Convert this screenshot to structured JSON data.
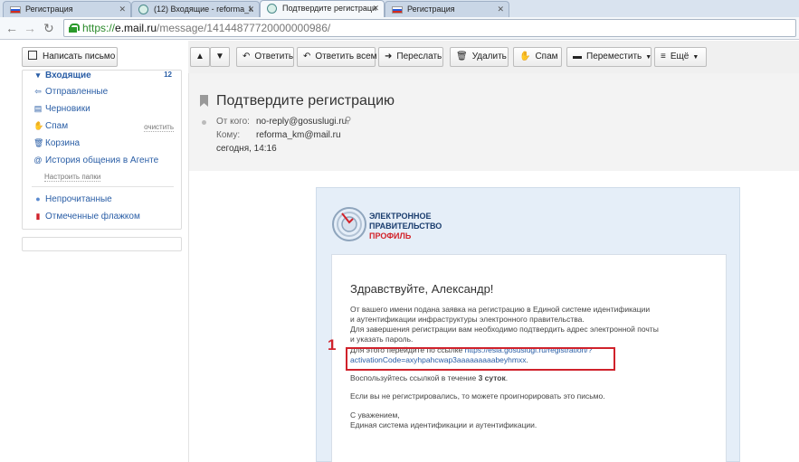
{
  "browser": {
    "tabs": [
      {
        "title": "Регистрация"
      },
      {
        "title": "(12) Входящие - reforma_k"
      },
      {
        "title": "Подтвердите регистраци"
      },
      {
        "title": "Регистрация"
      }
    ],
    "url": {
      "scheme": "https://",
      "host": "e.mail.ru",
      "path": "/message/14144877720000000986/"
    }
  },
  "compose_label": "Написать письмо",
  "toolbar": {
    "reply": "Ответить",
    "reply_all": "Ответить всем",
    "forward": "Переслать",
    "delete": "Удалить",
    "spam": "Спам",
    "move": "Переместить",
    "more": "Ещё"
  },
  "sidebar": {
    "inbox_label": "Входящие",
    "inbox_count": "12",
    "sent": "Отправленные",
    "drafts": "Черновики",
    "spam": "Спам",
    "spam_clear": "очистить",
    "trash": "Корзина",
    "agent_history": "История общения в Агенте",
    "configure_folders": "Настроить папки",
    "unread": "Непрочитанные",
    "flagged": "Отмеченные флажком"
  },
  "message": {
    "subject": "Подтвердите регистрацию",
    "from_label": "От кого:",
    "from_value": "no-reply@gosuslugi.ru",
    "to_label": "Кому:",
    "to_value": "reforma_km@mail.ru",
    "date": "сегодня, 14:16"
  },
  "logo": {
    "line1": "ЭЛЕКТРОННОЕ",
    "line2": "ПРАВИТЕЛЬСТВО",
    "line3": "ПРОФИЛЬ"
  },
  "body": {
    "greeting": "Здравствуйте, Александр!",
    "p1_l1": "От вашего имени подана заявка на регистрацию в Единой системе идентификации",
    "p1_l2": "и аутентификации инфраструктуры электронного правительства.",
    "p1_l3": "Для завершения регистрации вам необходимо подтвердить адрес электронной почты",
    "p1_l4": "и указать пароль.",
    "link_prefix": "Для этого перейдите по ссылке ",
    "link_l1": "https://esia.gosuslugi.ru/registration/?",
    "link_l2": "activationCode=axyhpahcwap3aaaaaaaaabeyhmxx",
    "link_suffix": ".",
    "validity_prefix": "Воспользуйтесь ссылкой в течение ",
    "validity_bold": "3 суток",
    "validity_suffix": ".",
    "ignore": "Если вы не регистрировались, то можете проигнорировать это письмо.",
    "regards": "С уважением,",
    "signature": "Единая система идентификации и аутентификации."
  },
  "annotation": {
    "marker": "1"
  }
}
